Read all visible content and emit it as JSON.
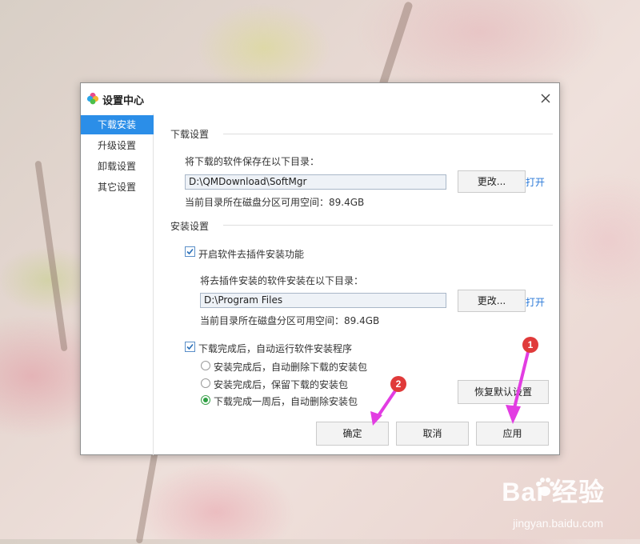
{
  "window": {
    "title": "设置中心"
  },
  "sidebar": {
    "items": [
      {
        "label": "下载安装",
        "active": true
      },
      {
        "label": "升级设置",
        "active": false
      },
      {
        "label": "卸载设置",
        "active": false
      },
      {
        "label": "其它设置",
        "active": false
      }
    ]
  },
  "download": {
    "section_title": "下载设置",
    "save_label": "将下载的软件保存在以下目录：",
    "path": "D:\\QMDownload\\SoftMgr",
    "change_label": "更改...",
    "open_label": "打开",
    "free_space": "当前目录所在磁盘分区可用空间：89.4GB"
  },
  "install": {
    "section_title": "安装设置",
    "plugin_option": {
      "label": "开启软件去插件安装功能",
      "checked": true
    },
    "install_dir_label": "将去插件安装的软件安装在以下目录：",
    "path": "D:\\Program Files",
    "change_label": "更改...",
    "open_label": "打开",
    "free_space": "当前目录所在磁盘分区可用空间：89.4GB",
    "auto_run_option": {
      "label": "下载完成后，自动运行软件安装程序",
      "checked": true
    },
    "radio_options": [
      {
        "label": "安装完成后，自动删除下载的安装包",
        "selected": false
      },
      {
        "label": "安装完成后，保留下载的安装包",
        "selected": false
      },
      {
        "label": "下载完成一周后，自动删除安装包",
        "selected": true
      }
    ],
    "restore_label": "恢复默认设置"
  },
  "footer": {
    "ok_label": "确定",
    "cancel_label": "取消",
    "apply_label": "应用"
  },
  "annotations": {
    "badge_1": "1",
    "badge_2": "2",
    "marker_color": "#e23de2"
  },
  "watermark": {
    "brand": "Bai  经验",
    "url": "jingyan.baidu.com"
  },
  "colors": {
    "accent": "#2b8ee8",
    "link": "#2b7ad8",
    "badge": "#e03a3a"
  }
}
